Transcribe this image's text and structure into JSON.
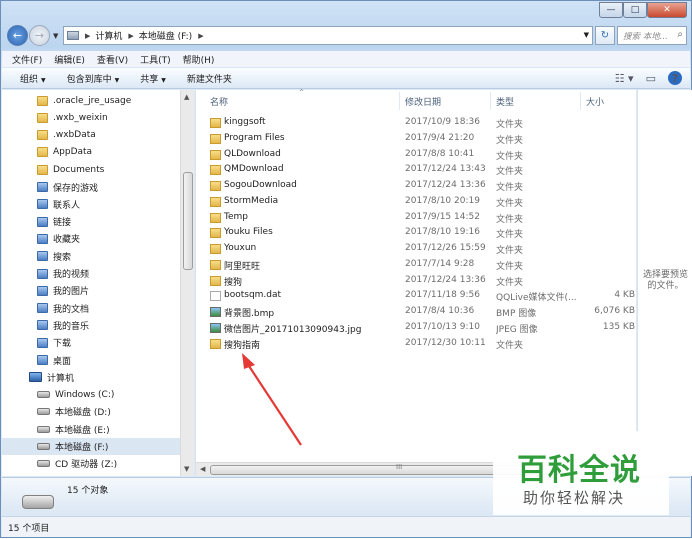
{
  "window": {
    "caption_buttons": {
      "minimize": "—",
      "maximize": "□",
      "close": "✕"
    }
  },
  "address": {
    "back_icon": "←",
    "forward_icon": "→",
    "crumbs": [
      "计算机",
      "本地磁盘 (F:)"
    ],
    "refresh_icon": "↻",
    "search_placeholder": "搜索 本地..."
  },
  "menu": [
    "文件(F)",
    "编辑(E)",
    "查看(V)",
    "工具(T)",
    "帮助(H)"
  ],
  "toolbar": {
    "organize": "组织",
    "include_library": "包含到库中",
    "share": "共享",
    "new_folder": "新建文件夹"
  },
  "nav": {
    "items": [
      {
        "label": ".oracle_jre_usage",
        "icon": "folder"
      },
      {
        "label": ".wxb_weixin",
        "icon": "folder"
      },
      {
        "label": ".wxbData",
        "icon": "folder"
      },
      {
        "label": "AppData",
        "icon": "folder"
      },
      {
        "label": "Documents",
        "icon": "folder"
      },
      {
        "label": "保存的游戏",
        "icon": "special"
      },
      {
        "label": "联系人",
        "icon": "special"
      },
      {
        "label": "链接",
        "icon": "special"
      },
      {
        "label": "收藏夹",
        "icon": "special"
      },
      {
        "label": "搜索",
        "icon": "special"
      },
      {
        "label": "我的视频",
        "icon": "special"
      },
      {
        "label": "我的图片",
        "icon": "special"
      },
      {
        "label": "我的文档",
        "icon": "special"
      },
      {
        "label": "我的音乐",
        "icon": "special"
      },
      {
        "label": "下载",
        "icon": "special"
      },
      {
        "label": "桌面",
        "icon": "special"
      },
      {
        "label": "计算机",
        "icon": "computer"
      },
      {
        "label": "Windows (C:)",
        "icon": "drive"
      },
      {
        "label": "本地磁盘 (D:)",
        "icon": "drive"
      },
      {
        "label": "本地磁盘 (E:)",
        "icon": "drive"
      },
      {
        "label": "本地磁盘 (F:)",
        "icon": "drive",
        "selected": true
      },
      {
        "label": "CD 驱动器 (Z:)",
        "icon": "drive"
      }
    ]
  },
  "columns": {
    "name": "名称",
    "date": "修改日期",
    "type": "类型",
    "size": "大小"
  },
  "files": [
    {
      "name": "kinggsoft",
      "date": "2017/10/9 18:36",
      "type": "文件夹",
      "size": "",
      "icon": "folder"
    },
    {
      "name": "Program Files",
      "date": "2017/9/4 21:20",
      "type": "文件夹",
      "size": "",
      "icon": "folder"
    },
    {
      "name": "QLDownload",
      "date": "2017/8/8 10:41",
      "type": "文件夹",
      "size": "",
      "icon": "folder"
    },
    {
      "name": "QMDownload",
      "date": "2017/12/24 13:43",
      "type": "文件夹",
      "size": "",
      "icon": "folder"
    },
    {
      "name": "SogouDownload",
      "date": "2017/12/24 13:36",
      "type": "文件夹",
      "size": "",
      "icon": "folder"
    },
    {
      "name": "StormMedia",
      "date": "2017/8/10 20:19",
      "type": "文件夹",
      "size": "",
      "icon": "folder"
    },
    {
      "name": "Temp",
      "date": "2017/9/15 14:52",
      "type": "文件夹",
      "size": "",
      "icon": "folder"
    },
    {
      "name": "Youku Files",
      "date": "2017/8/10 19:16",
      "type": "文件夹",
      "size": "",
      "icon": "folder"
    },
    {
      "name": "Youxun",
      "date": "2017/12/26 15:59",
      "type": "文件夹",
      "size": "",
      "icon": "folder"
    },
    {
      "name": "阿里旺旺",
      "date": "2017/7/14 9:28",
      "type": "文件夹",
      "size": "",
      "icon": "folder"
    },
    {
      "name": "搜狗",
      "date": "2017/12/24 13:36",
      "type": "文件夹",
      "size": "",
      "icon": "folder"
    },
    {
      "name": "bootsqm.dat",
      "date": "2017/11/18 9:56",
      "type": "QQLive媒体文件(...",
      "size": "4 KB",
      "icon": "file"
    },
    {
      "name": "背景图.bmp",
      "date": "2017/8/4 10:36",
      "type": "BMP 图像",
      "size": "6,076 KB",
      "icon": "img"
    },
    {
      "name": "微信图片_20171013090943.jpg",
      "date": "2017/10/13 9:10",
      "type": "JPEG 图像",
      "size": "135 KB",
      "icon": "img"
    },
    {
      "name": "搜狗指南",
      "date": "2017/12/30 10:11",
      "type": "文件夹",
      "size": "",
      "icon": "folder"
    }
  ],
  "preview": {
    "text_line1": "选择要预览",
    "text_line2": "的文件。"
  },
  "details": {
    "count": "15 个对象"
  },
  "status": {
    "text": "15 个项目"
  },
  "watermark": {
    "line1": "百科全说",
    "line2": "助你轻松解决"
  },
  "colors": {
    "arrow": "#e53935",
    "watermark_green": "#2e9d3a"
  }
}
